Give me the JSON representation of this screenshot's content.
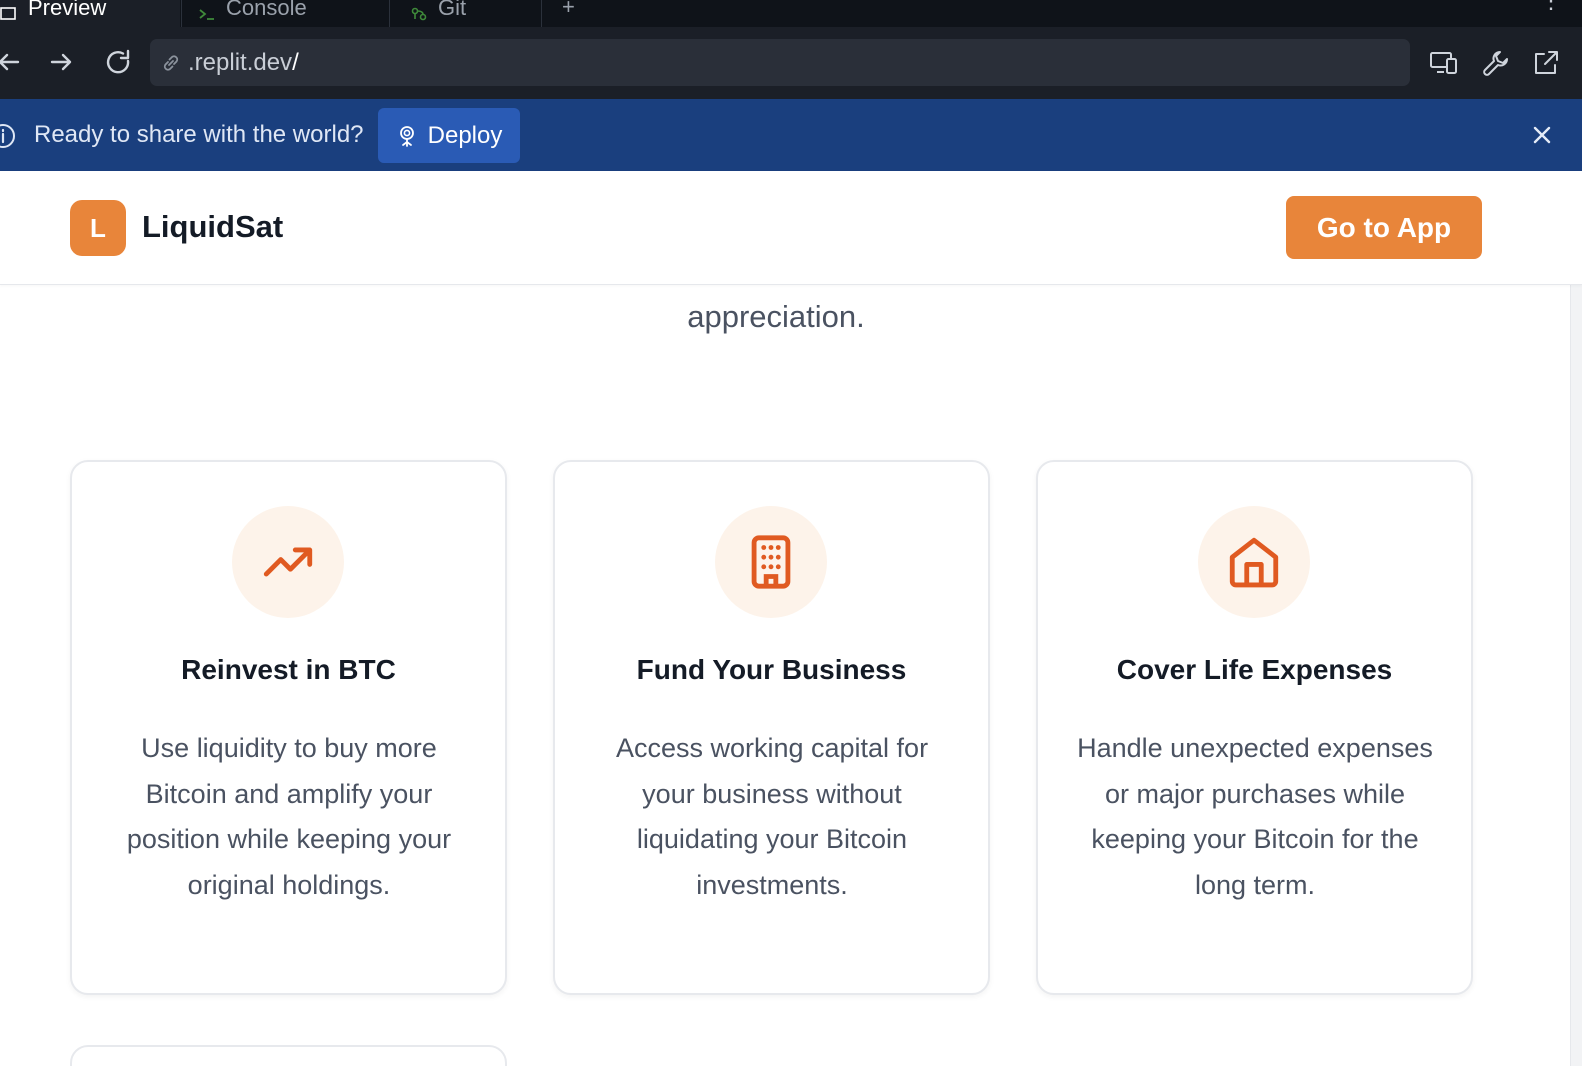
{
  "browser": {
    "tabs": [
      {
        "label": "Preview",
        "active": true
      },
      {
        "label": "Console",
        "active": false
      },
      {
        "label": "Git",
        "active": false
      }
    ],
    "new_tab": "+",
    "url": ".replit.dev",
    "url_suffix": "/"
  },
  "banner": {
    "message": "Ready to share with the world?",
    "deploy_label": "Deploy"
  },
  "header": {
    "logo_letter": "L",
    "brand": "LiquidSat",
    "cta_label": "Go to App"
  },
  "intro": {
    "tail": "appreciation."
  },
  "cards": [
    {
      "icon": "trending-up-icon",
      "title": "Reinvest in BTC",
      "body": "Use liquidity to buy more Bitcoin and amplify your position while keeping your original holdings."
    },
    {
      "icon": "building-icon",
      "title": "Fund Your Business",
      "body": "Access working capital for your business without liquidating your Bitcoin investments."
    },
    {
      "icon": "home-icon",
      "title": "Cover Life Expenses",
      "body": "Handle unexpected expenses or major purchases while keeping your Bitcoin for the long term."
    }
  ],
  "colors": {
    "accent": "#e8853a",
    "icon": "#e05a21",
    "banner": "#1a3f7e",
    "chrome": "#1b1f27"
  }
}
